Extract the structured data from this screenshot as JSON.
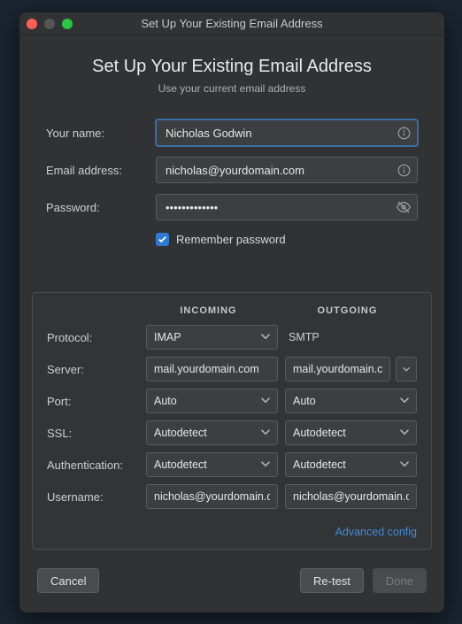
{
  "window": {
    "title": "Set Up Your Existing Email Address"
  },
  "header": {
    "title": "Set Up Your Existing Email Address",
    "subtitle": "Use your current email address"
  },
  "fields": {
    "name_label": "Your name:",
    "name_value": "Nicholas Godwin",
    "email_label": "Email address:",
    "email_value": "nicholas@yourdomain.com",
    "password_label": "Password:",
    "password_value": "•••••••••••••",
    "remember_label": "Remember password"
  },
  "server_section": {
    "incoming_header": "INCOMING",
    "outgoing_header": "OUTGOING",
    "rows": {
      "protocol_label": "Protocol:",
      "protocol_in": "IMAP",
      "protocol_out": "SMTP",
      "server_label": "Server:",
      "server_in": "mail.yourdomain.com",
      "server_out": "mail.yourdomain.com",
      "port_label": "Port:",
      "port_in": "Auto",
      "port_out": "Auto",
      "ssl_label": "SSL:",
      "ssl_in": "Autodetect",
      "ssl_out": "Autodetect",
      "auth_label": "Authentication:",
      "auth_in": "Autodetect",
      "auth_out": "Autodetect",
      "user_label": "Username:",
      "user_in": "nicholas@yourdomain.com",
      "user_out": "nicholas@yourdomain.com"
    },
    "advanced_link": "Advanced config"
  },
  "footer": {
    "cancel": "Cancel",
    "retest": "Re-test",
    "done": "Done"
  }
}
